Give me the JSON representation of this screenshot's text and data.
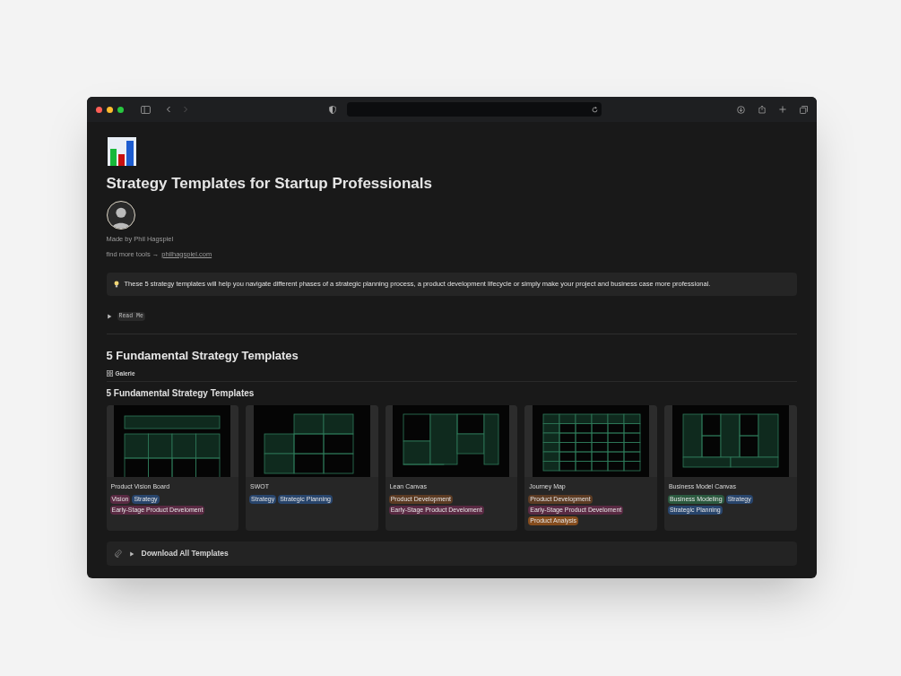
{
  "page": {
    "title": "Strategy Templates for Startup Professionals",
    "author": "Made by Phil Hagspiel",
    "more_tools": "find more tools →",
    "link": "philhagspiel.com"
  },
  "callout": "These 5 strategy templates will help you navigate different phases of a strategic planning process, a product development lifecycle or simply make your project and business case more professional.",
  "toggle": {
    "label": "Read Me",
    "expanded": false
  },
  "section": {
    "heading": "5 Fundamental Strategy Templates",
    "view_tab": "Galerie",
    "gallery_title": "5 Fundamental Strategy Templates"
  },
  "cards": [
    {
      "title": "Product Vision Board",
      "kind": "vision_board",
      "tags": [
        {
          "label": "Vision",
          "color": "#5a2a43"
        },
        {
          "label": "Strategy",
          "color": "#28456c"
        },
        {
          "label": "Early-Stage Product Develoment",
          "color": "#5a2a43"
        }
      ]
    },
    {
      "title": "SWOT",
      "kind": "swot",
      "tags": [
        {
          "label": "Strategy",
          "color": "#28456c"
        },
        {
          "label": "Strategic Planning",
          "color": "#28456c"
        }
      ]
    },
    {
      "title": "Lean Canvas",
      "kind": "lean_canvas",
      "tags": [
        {
          "label": "Product Development",
          "color": "#5c3b23"
        },
        {
          "label": "Early-Stage Product Develoment",
          "color": "#5a2a43"
        }
      ]
    },
    {
      "title": "Journey Map",
      "kind": "journey_map",
      "tags": [
        {
          "label": "Product Development",
          "color": "#5c3b23"
        },
        {
          "label": "Early-Stage Product Develoment",
          "color": "#5a2a43"
        },
        {
          "label": "Product Analysis",
          "color": "#854c1d"
        }
      ]
    },
    {
      "title": "Business Model Canvas",
      "kind": "business_model",
      "tags": [
        {
          "label": "Business Modeling",
          "color": "#2b593f"
        },
        {
          "label": "Strategy",
          "color": "#28456c"
        },
        {
          "label": "Strategic Planning",
          "color": "#28456c"
        }
      ]
    }
  ],
  "download": {
    "label": "Download All Templates",
    "expanded": false
  }
}
